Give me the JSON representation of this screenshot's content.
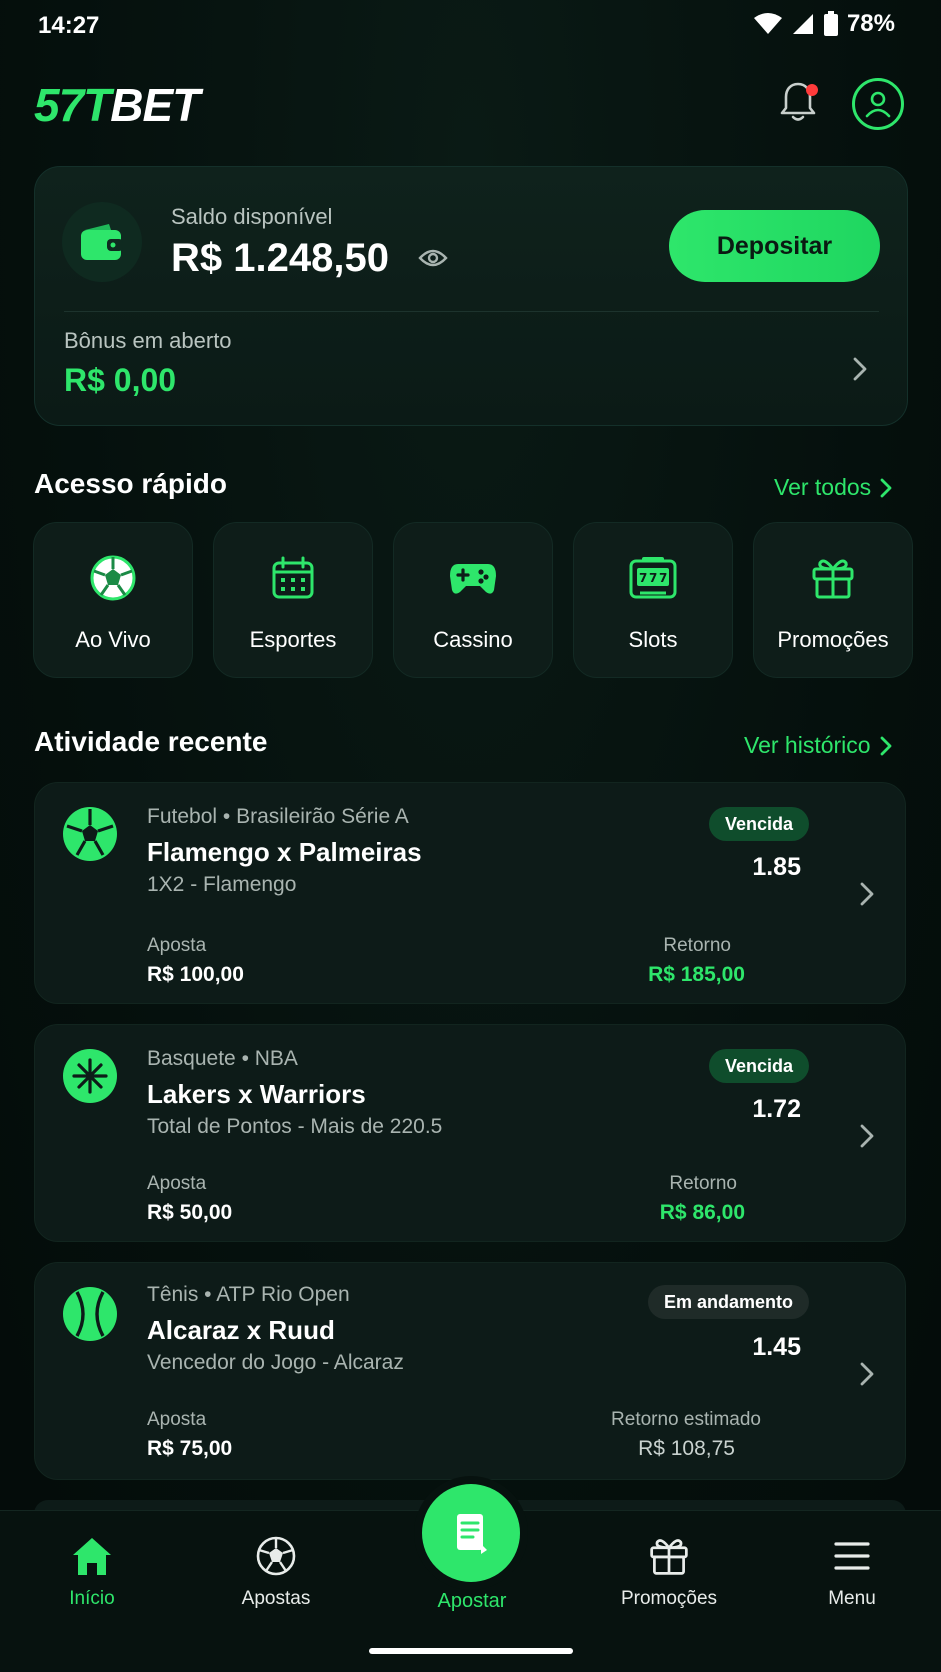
{
  "status_bar": {
    "time": "14:27",
    "battery": "78%"
  },
  "header": {
    "logo_green": "57T",
    "logo_white": "BET"
  },
  "balance": {
    "label": "Saldo disponível",
    "value": "R$ 1.248,50",
    "deposit_label": "Depositar",
    "bonus_label": "Bônus em aberto",
    "bonus_value": "R$ 0,00"
  },
  "quick_access": {
    "title": "Acesso rápido",
    "link": "Ver todos",
    "items": [
      {
        "label": "Ao Vivo",
        "icon": "soccer-ball-icon"
      },
      {
        "label": "Esportes",
        "icon": "calendar-icon"
      },
      {
        "label": "Cassino",
        "icon": "gamepad-icon"
      },
      {
        "label": "Slots",
        "icon": "slot-machine-icon"
      },
      {
        "label": "Promoções",
        "icon": "gift-icon"
      }
    ]
  },
  "recent_activity": {
    "title": "Atividade recente",
    "link": "Ver histórico",
    "bets": [
      {
        "meta": "Futebol • Brasileirão Série A",
        "title": "Flamengo x Palmeiras",
        "market": "1X2 - Flamengo",
        "status": "Vencida",
        "odds": "1.85",
        "stake_label": "Aposta",
        "stake": "R$ 100,00",
        "return_label": "Retorno",
        "return": "R$ 185,00",
        "icon": "soccer-ball-icon"
      },
      {
        "meta": "Basquete • NBA",
        "title": "Lakers x Warriors",
        "market": "Total de Pontos - Mais de 220.5",
        "status": "Vencida",
        "odds": "1.72",
        "stake_label": "Aposta",
        "stake": "R$ 50,00",
        "return_label": "Retorno",
        "return": "R$ 86,00",
        "icon": "basketball-icon"
      },
      {
        "meta": "Tênis • ATP Rio Open",
        "title": "Alcaraz x Ruud",
        "market": "Vencedor do Jogo - Alcaraz",
        "status": "Em andamento",
        "odds": "1.45",
        "stake_label": "Aposta",
        "stake": "R$ 75,00",
        "return_label": "Retorno estimado",
        "return": "R$ 108,75",
        "icon": "tennis-ball-icon"
      }
    ]
  },
  "bottom_nav": {
    "items": [
      {
        "label": "Início",
        "icon": "home-icon"
      },
      {
        "label": "Apostas",
        "icon": "soccer-ball-icon"
      },
      {
        "label": "Apostar",
        "icon": "betslip-icon"
      },
      {
        "label": "Promoções",
        "icon": "gift-icon"
      },
      {
        "label": "Menu",
        "icon": "hamburger-menu-icon"
      }
    ]
  },
  "colors": {
    "accent": "#2ee66b",
    "background": "#05100d",
    "card": "#0d1b18",
    "notification": "#ff3b3b"
  }
}
